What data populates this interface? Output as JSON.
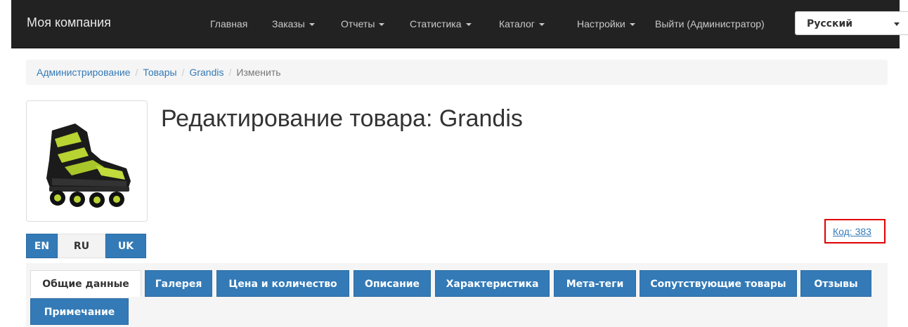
{
  "navbar": {
    "brand": "Моя компания",
    "items": [
      {
        "label": "Главная",
        "has_caret": false
      },
      {
        "label": "Заказы",
        "has_caret": true
      },
      {
        "label": "Отчеты",
        "has_caret": true
      },
      {
        "label": "Статистика",
        "has_caret": true
      },
      {
        "label": "Каталог",
        "has_caret": true
      },
      {
        "label": "Настройки",
        "has_caret": true
      },
      {
        "label": "Выйти (Администратор)",
        "has_caret": false
      }
    ],
    "language_select": {
      "value": "Русский"
    }
  },
  "breadcrumb": {
    "items": [
      "Администрирование",
      "Товары",
      "Grandis"
    ],
    "active": "Изменить"
  },
  "page": {
    "title": "Редактирование товара: Grandis",
    "code_link": "Код: 383",
    "product_image": "inline-skate"
  },
  "languages": [
    {
      "label": "EN",
      "active": false
    },
    {
      "label": "RU",
      "active": true
    },
    {
      "label": "UK",
      "active": false
    }
  ],
  "tabs": [
    {
      "label": "Общие данные",
      "active": true
    },
    {
      "label": "Галерея",
      "active": false
    },
    {
      "label": "Цена и количество",
      "active": false
    },
    {
      "label": "Описание",
      "active": false
    },
    {
      "label": "Характеристика",
      "active": false
    },
    {
      "label": "Мета-теги",
      "active": false
    },
    {
      "label": "Сопутствующие товары",
      "active": false
    },
    {
      "label": "Отзывы",
      "active": false
    },
    {
      "label": "Примечание",
      "active": false
    }
  ],
  "colors": {
    "navbar_bg": "#222222",
    "primary": "#337ab7",
    "highlight_border": "#e00000"
  }
}
